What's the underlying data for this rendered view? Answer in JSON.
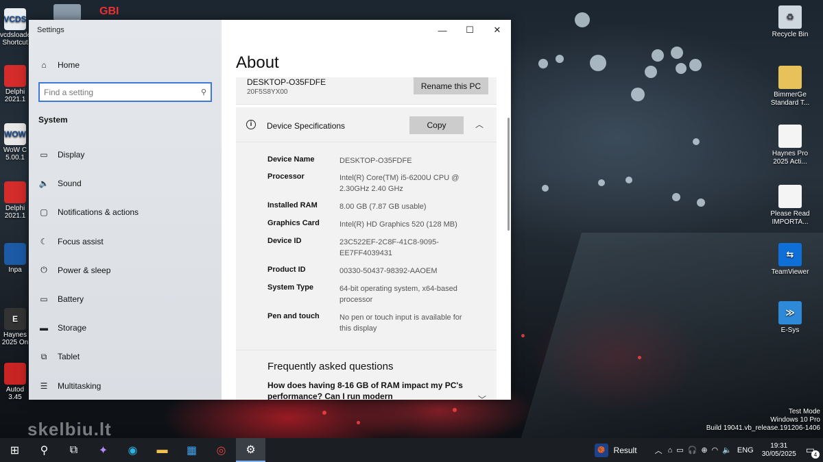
{
  "desktop": {
    "left_icons": [
      {
        "label": "vcdsloader Shortcut",
        "icon": "vcds-icon",
        "color": "#e9eef3",
        "glyph": "VCDS"
      },
      {
        "label": "Delphi 2021.1",
        "icon": "delphi-icon",
        "color": "#d42b2b",
        "glyph": ""
      },
      {
        "label": "WoW C 5.00.1",
        "icon": "wow-icon",
        "color": "#e8e8e8",
        "glyph": "WOW"
      },
      {
        "label": "Delphi 2021.1",
        "icon": "delphi-icon",
        "color": "#d42b2b",
        "glyph": ""
      },
      {
        "label": "Inpa",
        "icon": "bmw-icon",
        "color": "#1c5aa6",
        "glyph": ""
      },
      {
        "label": "Haynes 2025 On",
        "icon": "haynes-icon",
        "color": "#333",
        "glyph": "E"
      },
      {
        "label": "Autod 3.45",
        "icon": "autodata-icon",
        "color": "#c82424",
        "glyph": ""
      }
    ],
    "right_icons": [
      {
        "label": "Recycle Bin",
        "icon": "recycle-bin-icon",
        "color": "#cfd8df",
        "glyph": "♻"
      },
      {
        "label": "BimmerGe Standard T...",
        "icon": "folder-icon",
        "color": "#e8c15a",
        "glyph": ""
      },
      {
        "label": "Haynes Pro 2025 Acti...",
        "icon": "document-icon",
        "color": "#f4f4f4",
        "glyph": ""
      },
      {
        "label": "Please Read IMPORTA...",
        "icon": "document-icon",
        "color": "#f4f4f4",
        "glyph": ""
      },
      {
        "label": "TeamViewer",
        "icon": "teamviewer-icon",
        "color": "#0e6fd8",
        "glyph": "⇆"
      },
      {
        "label": "E-Sys",
        "icon": "esys-icon",
        "color": "#2e8ad8",
        "glyph": "≫"
      }
    ],
    "watermark": "skelbiu.lt",
    "sysinfo": [
      "Test Mode",
      "Windows 10 Pro",
      "Build 19041.vb_release.191206-1406"
    ]
  },
  "window": {
    "title": "Settings",
    "controls": {
      "minimize": "—",
      "maximize": "☐",
      "close": "✕"
    },
    "sidebar": {
      "home_label": "Home",
      "search_placeholder": "Find a setting",
      "section": "System",
      "items": [
        {
          "label": "Display",
          "icon": "display-icon",
          "glyph": "▭"
        },
        {
          "label": "Sound",
          "icon": "sound-icon",
          "glyph": "🔈"
        },
        {
          "label": "Notifications & actions",
          "icon": "notifications-icon",
          "glyph": "▢"
        },
        {
          "label": "Focus assist",
          "icon": "focus-assist-icon",
          "glyph": "☾"
        },
        {
          "label": "Power & sleep",
          "icon": "power-icon",
          "glyph": "⏻"
        },
        {
          "label": "Battery",
          "icon": "battery-icon",
          "glyph": "▭"
        },
        {
          "label": "Storage",
          "icon": "storage-icon",
          "glyph": "▬"
        },
        {
          "label": "Tablet",
          "icon": "tablet-icon",
          "glyph": "⧉"
        },
        {
          "label": "Multitasking",
          "icon": "multitasking-icon",
          "glyph": "☰"
        }
      ]
    },
    "content": {
      "title": "About",
      "pc_name": "DESKTOP-O35FDFE",
      "pc_sub": "20F5S8YX00",
      "rename_label": "Rename this PC",
      "spec_title": "Device Specifications",
      "copy_label": "Copy",
      "specs": [
        {
          "label": "Device Name",
          "value": "DESKTOP-O35FDFE"
        },
        {
          "label": "Processor",
          "value": "Intel(R) Core(TM) i5-6200U CPU @ 2.30GHz 2.40 GHz"
        },
        {
          "label": "Installed RAM",
          "value": "8.00 GB (7.87 GB usable)"
        },
        {
          "label": "Graphics Card",
          "value": "Intel(R) HD Graphics 520 (128 MB)"
        },
        {
          "label": "Device ID",
          "value": "23C522EF-2C8F-41C8-9095-EE7FF4039431"
        },
        {
          "label": "Product ID",
          "value": "00330-50437-98392-AAOEM"
        },
        {
          "label": "System Type",
          "value": "64-bit operating system, x64-based processor"
        },
        {
          "label": "Pen and touch",
          "value": "No pen or touch input is available for this display"
        }
      ],
      "faq_title": "Frequently asked questions",
      "faq_question": "How does having 8-16 GB of RAM impact my PC's performance? Can I run modern"
    }
  },
  "taskbar": {
    "apps": [
      {
        "name": "start-button",
        "icon": "windows-icon",
        "glyph": "⊞",
        "color": "#ffffff"
      },
      {
        "name": "search-button",
        "icon": "search-icon",
        "glyph": "⚲",
        "color": "#ffffff"
      },
      {
        "name": "task-view-button",
        "icon": "task-view-icon",
        "glyph": "⧉",
        "color": "#ffffff"
      },
      {
        "name": "copilot-button",
        "icon": "copilot-icon",
        "glyph": "✦",
        "color": "#b58cff"
      },
      {
        "name": "edge-button",
        "icon": "edge-icon",
        "glyph": "◉",
        "color": "#2bb3e6"
      },
      {
        "name": "file-explorer-button",
        "icon": "folder-icon",
        "glyph": "▬",
        "color": "#f2c14e"
      },
      {
        "name": "store-button",
        "icon": "store-icon",
        "glyph": "▦",
        "color": "#3fa3f0"
      },
      {
        "name": "chrome-button",
        "icon": "chrome-icon",
        "glyph": "◎",
        "color": "#e8453c"
      },
      {
        "name": "settings-button",
        "icon": "gear-icon",
        "glyph": "⚙",
        "color": "#ffffff"
      }
    ],
    "news_label": "Result",
    "language": "ENG",
    "time": "19:31",
    "date": "30/05/2025",
    "notification_count": "4"
  }
}
